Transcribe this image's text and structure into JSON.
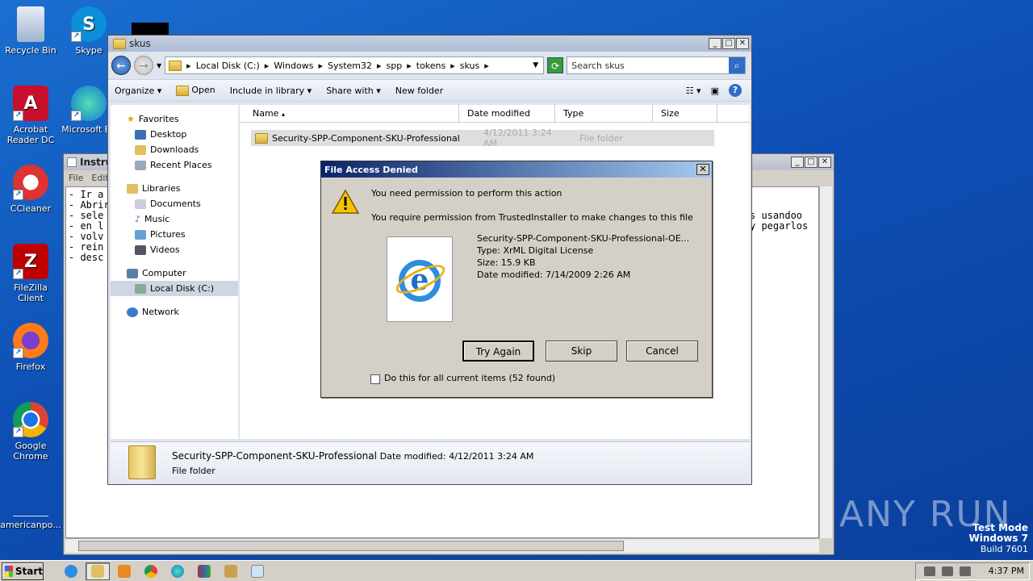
{
  "desktop": {
    "icons": [
      {
        "label": "Recycle Bin"
      },
      {
        "label": "Skype"
      },
      {
        "label": "Acrobat Reader DC"
      },
      {
        "label": "Microsoft Ed"
      },
      {
        "label": "CCleaner"
      },
      {
        "label": "FileZilla Client"
      },
      {
        "label": "Firefox"
      },
      {
        "label": "Google Chrome"
      },
      {
        "label": "americanpo..."
      }
    ]
  },
  "notepad": {
    "title": "Instru",
    "menu": [
      "File",
      "Edit"
    ],
    "lines": [
      "- Ir a",
      "- Abrir",
      "- sele",
      "- en l",
      "- volv",
      "- rein",
      "- desc"
    ],
    "right_lines": [
      "s usandoo",
      "y pegarlos"
    ]
  },
  "explorer": {
    "title": "skus",
    "breadcrumbs": [
      "Local Disk (C:)",
      "Windows",
      "System32",
      "spp",
      "tokens",
      "skus"
    ],
    "search_placeholder": "Search skus",
    "toolbar": {
      "organize": "Organize",
      "open": "Open",
      "include": "Include in library",
      "share": "Share with",
      "new_folder": "New folder"
    },
    "nav": {
      "favorites": "Favorites",
      "desktop": "Desktop",
      "downloads": "Downloads",
      "recent": "Recent Places",
      "libraries": "Libraries",
      "documents": "Documents",
      "music": "Music",
      "pictures": "Pictures",
      "videos": "Videos",
      "computer": "Computer",
      "local_disk": "Local Disk (C:)",
      "network": "Network"
    },
    "columns": {
      "name": "Name",
      "date": "Date modified",
      "type": "Type",
      "size": "Size"
    },
    "file": {
      "name": "Security-SPP-Component-SKU-Professional",
      "date": "4/12/2011 3:24 AM",
      "type": "File folder"
    },
    "details": {
      "name": "Security-SPP-Component-SKU-Professional",
      "date_label": "Date modified:",
      "date": "4/12/2011 3:24 AM",
      "type": "File folder"
    }
  },
  "dialog": {
    "title": "File Access Denied",
    "heading": "You need permission to perform this action",
    "message": "You require permission from TrustedInstaller to make changes to this file",
    "file_name": "Security-SPP-Component-SKU-Professional-OE...",
    "file_type": "Type: XrML Digital License",
    "file_size": "Size: 15.9 KB",
    "file_date": "Date modified: 7/14/2009 2:26 AM",
    "buttons": {
      "try_again": "Try Again",
      "skip": "Skip",
      "cancel": "Cancel"
    },
    "checkbox_label": "Do this for all current items (52 found)"
  },
  "watermark": "ANY RUN",
  "testmode": {
    "line1": "Test Mode",
    "line2": "Windows 7",
    "line3": "Build 7601"
  },
  "taskbar": {
    "start": "Start",
    "clock": "4:37 PM"
  },
  "colors": {
    "desktop": "#0e4fb5",
    "dialog_title": "#0a246a",
    "taskbar": "#d4d0c8"
  }
}
